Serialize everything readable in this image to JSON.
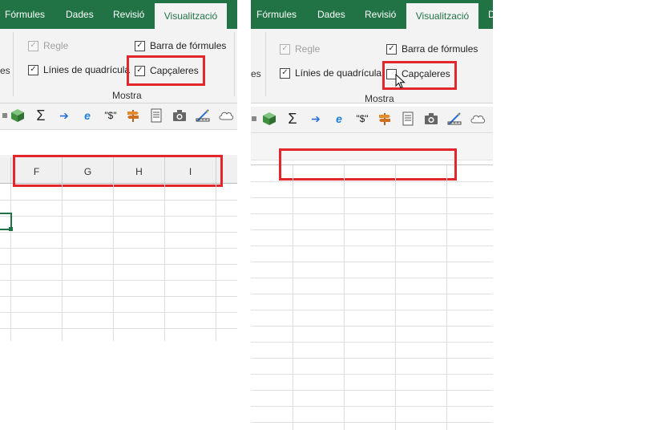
{
  "left": {
    "tabs": [
      {
        "label": "Fórmules",
        "active": false
      },
      {
        "label": "Dades",
        "active": false
      },
      {
        "label": "Revisió",
        "active": false
      },
      {
        "label": "Visualització",
        "active": true
      }
    ],
    "ribbon": {
      "truncated_left": "es",
      "checkboxes": {
        "regle": {
          "label": "Regle",
          "checked": true,
          "disabled": true
        },
        "linies": {
          "label": "Línies de quadrícula",
          "checked": true
        },
        "barra": {
          "label": "Barra de fórmules",
          "checked": true
        },
        "capcaleres": {
          "label": "Capçaleres",
          "checked": true
        }
      },
      "group_label": "Mostra"
    },
    "column_headers": [
      "F",
      "G",
      "H",
      "I"
    ]
  },
  "right": {
    "tabs": [
      {
        "label": "Fórmules",
        "active": false
      },
      {
        "label": "Dades",
        "active": false
      },
      {
        "label": "Revisió",
        "active": false
      },
      {
        "label": "Visualització",
        "active": true
      },
      {
        "label": "D",
        "active": false
      }
    ],
    "ribbon": {
      "truncated_left": "es",
      "checkboxes": {
        "regle": {
          "label": "Regle",
          "checked": true,
          "disabled": true
        },
        "linies": {
          "label": "Línies de quadrícula",
          "checked": true
        },
        "barra": {
          "label": "Barra de fórmules",
          "checked": true
        },
        "capcaleres": {
          "label": "Capçaleres",
          "checked": false
        }
      },
      "group_label": "Mostra"
    }
  },
  "icons": {
    "qat": [
      "cube-icon",
      "sigma-icon",
      "arrow-right-icon",
      "internet-explorer-icon",
      "dollar-quote-icon",
      "signpost-icon",
      "document-icon",
      "camera-icon",
      "ruler-pencil-icon",
      "cloud-icon"
    ],
    "check_glyph": "✓",
    "sigma_glyph": "Σ",
    "arrow_glyph": "➔",
    "e_glyph": "e",
    "dollar_glyph": "\"$\""
  },
  "colors": {
    "excel_green": "#217346",
    "highlight_red": "#e3262c",
    "ribbon_bg": "#f3f3f3"
  }
}
